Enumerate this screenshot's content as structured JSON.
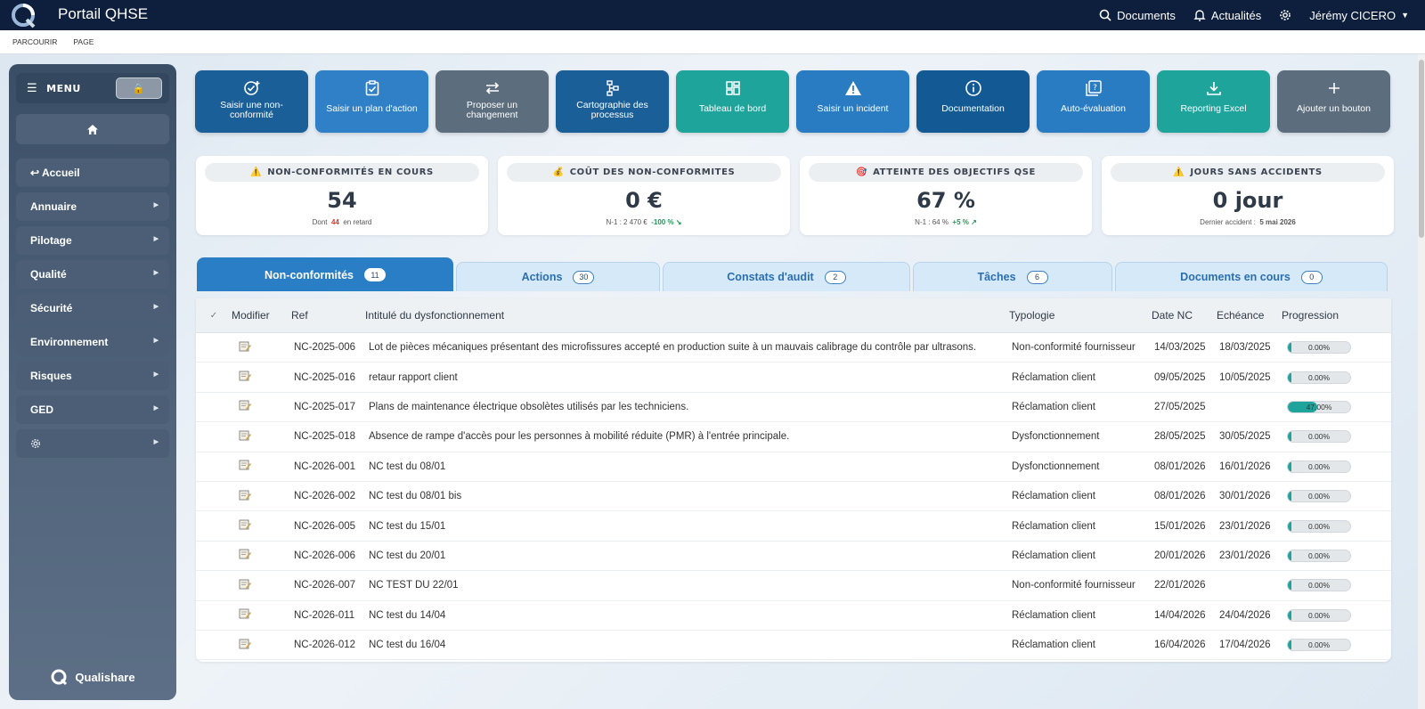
{
  "app": {
    "title": "Portail QHSE"
  },
  "topnav": {
    "documents": "Documents",
    "news": "Actualités",
    "user": "Jérémy CICERO"
  },
  "ribbon": {
    "browse": "PARCOURIR",
    "page": "PAGE"
  },
  "sidebar": {
    "menu_label": "MENU",
    "items": [
      {
        "label": "↩ Accueil"
      },
      {
        "label": "Annuaire"
      },
      {
        "label": "Pilotage"
      },
      {
        "label": "Qualité"
      },
      {
        "label": "Sécurité"
      },
      {
        "label": "Environnement"
      },
      {
        "label": "Risques"
      },
      {
        "label": "GED"
      }
    ],
    "brand": "Qualishare"
  },
  "actions": [
    {
      "label": "Saisir une non-conformité",
      "icon": "check-plus-icon",
      "color": "#1b5f98"
    },
    {
      "label": "Saisir un plan d'action",
      "icon": "clipboard-check-icon",
      "color": "#2f80c6"
    },
    {
      "label": "Proposer un changement",
      "icon": "swap-arrows-icon",
      "color": "#5c6d7d"
    },
    {
      "label": "Cartographie des processus",
      "icon": "process-map-icon",
      "color": "#1b5f98"
    },
    {
      "label": "Tableau de bord",
      "icon": "dashboard-icon",
      "color": "#1fa49c"
    },
    {
      "label": "Saisir un incident",
      "icon": "warning-icon",
      "color": "#2a7cc2"
    },
    {
      "label": "Documentation",
      "icon": "info-icon",
      "color": "#135a94"
    },
    {
      "label": "Auto-évaluation",
      "icon": "help-square-icon",
      "color": "#2a7cc2"
    },
    {
      "label": "Reporting Excel",
      "icon": "download-icon",
      "color": "#1fa49c"
    },
    {
      "label": "Ajouter un bouton",
      "icon": "plus-icon",
      "color": "#5c6d7d"
    }
  ],
  "kpis": {
    "nc": {
      "title": "NON-CONFORMITÉS EN COURS",
      "value": "54",
      "sub_prefix": "Dont",
      "sub_red": "44",
      "sub_suffix": "en retard"
    },
    "cost": {
      "title": "COÛT DES NON-CONFORMITES",
      "value": "0 €",
      "sub": "N-1 : 2 470 €",
      "sub_green": "-100 % ↘"
    },
    "goals": {
      "title": "ATTEINTE DES OBJECTIFS QSE",
      "value": "67 %",
      "sub": "N-1 : 64 %",
      "sub_green": "+5 % ↗"
    },
    "days": {
      "title": "JOURS SANS ACCIDENTS",
      "value": "0 jour",
      "sub": "Dernier accident :",
      "sub_bold": "5 mai 2026"
    }
  },
  "tabs": [
    {
      "label": "Non-conformités",
      "count": "11"
    },
    {
      "label": "Actions",
      "count": "30"
    },
    {
      "label": "Constats d'audit",
      "count": "2"
    },
    {
      "label": "Tâches",
      "count": "6"
    },
    {
      "label": "Documents en cours",
      "count": "0"
    }
  ],
  "table": {
    "headers": {
      "check": "✓",
      "modify": "Modifier",
      "ref": "Ref",
      "title": "Intitulé du dysfonctionnement",
      "type": "Typologie",
      "date": "Date NC",
      "due": "Echéance",
      "progress": "Progression"
    },
    "rows": [
      {
        "ref": "NC-2025-006",
        "title": "Lot de pièces mécaniques présentant des microfissures accepté en production suite à un mauvais calibrage du contrôle par ultrasons.",
        "type": "Non-conformité fournisseur",
        "date": "14/03/2025",
        "due": "18/03/2025",
        "progress": 0,
        "progress_label": "0.00%"
      },
      {
        "ref": "NC-2025-016",
        "title": "retaur rapport client",
        "type": "Réclamation client",
        "date": "09/05/2025",
        "due": "10/05/2025",
        "progress": 0,
        "progress_label": "0.00%"
      },
      {
        "ref": "NC-2025-017",
        "title": "Plans de maintenance électrique obsolètes utilisés par les techniciens.",
        "type": "Réclamation client",
        "date": "27/05/2025",
        "due": "",
        "progress": 47,
        "progress_label": "47.00%"
      },
      {
        "ref": "NC-2025-018",
        "title": "Absence de rampe d'accès pour les personnes à mobilité réduite (PMR) à l'entrée principale.",
        "type": "Dysfonctionnement",
        "date": "28/05/2025",
        "due": "30/05/2025",
        "progress": 0,
        "progress_label": "0.00%"
      },
      {
        "ref": "NC-2026-001",
        "title": "NC test du 08/01",
        "type": "Dysfonctionnement",
        "date": "08/01/2026",
        "due": "16/01/2026",
        "progress": 0,
        "progress_label": "0.00%"
      },
      {
        "ref": "NC-2026-002",
        "title": "NC test du 08/01 bis",
        "type": "Réclamation client",
        "date": "08/01/2026",
        "due": "30/01/2026",
        "progress": 0,
        "progress_label": "0.00%"
      },
      {
        "ref": "NC-2026-005",
        "title": "NC test du 15/01",
        "type": "Réclamation client",
        "date": "15/01/2026",
        "due": "23/01/2026",
        "progress": 0,
        "progress_label": "0.00%"
      },
      {
        "ref": "NC-2026-006",
        "title": "NC test du 20/01",
        "type": "Réclamation client",
        "date": "20/01/2026",
        "due": "23/01/2026",
        "progress": 0,
        "progress_label": "0.00%"
      },
      {
        "ref": "NC-2026-007",
        "title": "NC TEST DU 22/01",
        "type": "Non-conformité fournisseur",
        "date": "22/01/2026",
        "due": "",
        "progress": 0,
        "progress_label": "0.00%"
      },
      {
        "ref": "NC-2026-011",
        "title": "NC test du 14/04",
        "type": "Réclamation client",
        "date": "14/04/2026",
        "due": "24/04/2026",
        "progress": 0,
        "progress_label": "0.00%"
      },
      {
        "ref": "NC-2026-012",
        "title": "NC test du 16/04",
        "type": "Réclamation client",
        "date": "16/04/2026",
        "due": "17/04/2026",
        "progress": 0,
        "progress_label": "0.00%"
      }
    ]
  }
}
